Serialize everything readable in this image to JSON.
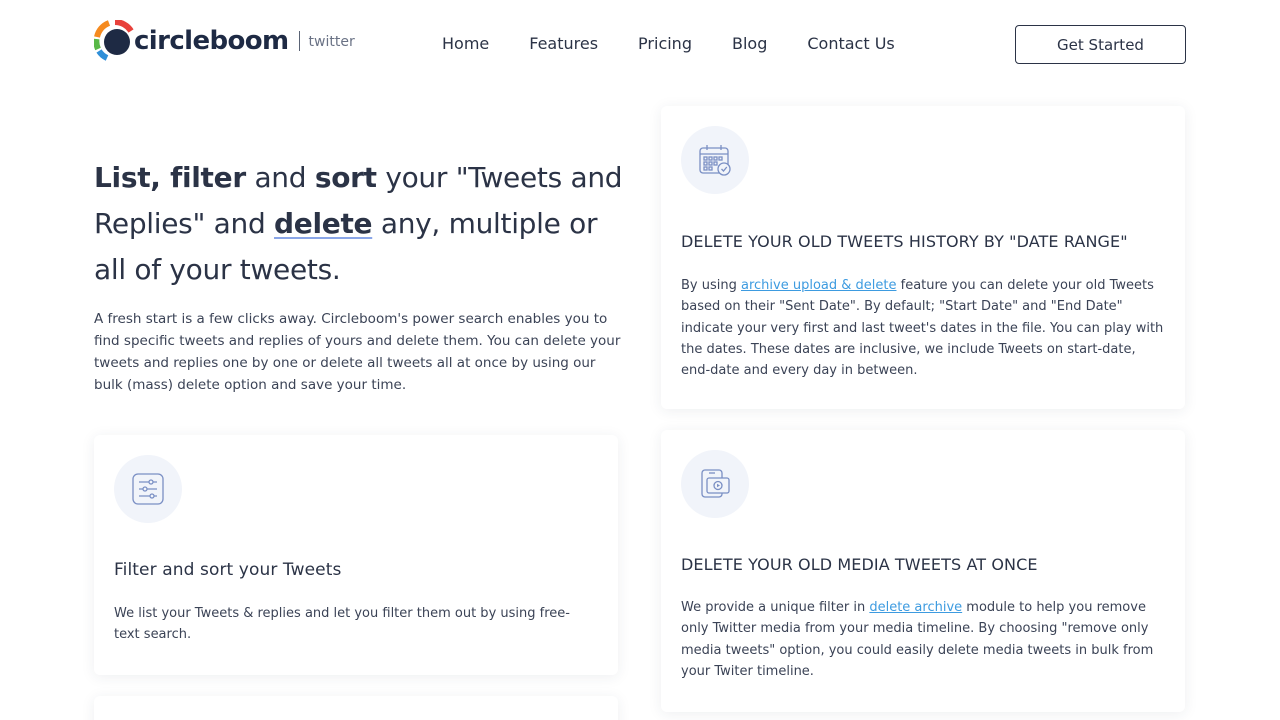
{
  "brand": {
    "name": "circleboom",
    "sub": "twitter",
    "colors": {
      "primary": "#1e2a44",
      "orange": "#f58a1f",
      "green": "#58b847",
      "blue": "#2f8fd8",
      "red": "#e8413b"
    }
  },
  "nav": {
    "items": [
      "Home",
      "Features",
      "Pricing",
      "Blog",
      "Contact Us"
    ],
    "cta": "Get Started"
  },
  "hero": {
    "title": {
      "p1": "List, filter",
      "p2": " and ",
      "p3": "sort",
      "p4": " your \"Tweets and Replies\" and ",
      "p5": "delete",
      "p6": " any, multiple or all of your tweets."
    },
    "text": "A fresh start is a few clicks away. Circleboom's power search enables you to find specific tweets and replies of yours and delete them. You can delete your tweets and replies one by one or delete all tweets all at once by using our bulk (mass) delete option and save your time."
  },
  "cards": {
    "date_range": {
      "icon": "calendar-check-icon",
      "title": "DELETE YOUR OLD TWEETS HISTORY BY \"DATE RANGE\"",
      "text_before": "By using ",
      "link": "archive upload & delete",
      "text_after": " feature you can delete your old Tweets based on their \"Sent Date\". By default; \"Start Date\" and \"End Date\" indicate your very first and last tweet's dates in the file. You can play with the dates. These dates are inclusive, we include Tweets on start-date, end-date and every day in between."
    },
    "media": {
      "icon": "media-device-icon",
      "title": "DELETE YOUR OLD MEDIA TWEETS AT ONCE",
      "text_before": "We provide a unique filter in ",
      "link": "delete archive",
      "text_after": " module to help you remove only Twitter media from your media timeline. By choosing \"remove only media tweets\" option, you could easily delete media tweets in bulk from your Twiter timeline."
    },
    "filter": {
      "icon": "filter-sliders-icon",
      "title": "Filter and sort your Tweets",
      "text": "We list your Tweets & replies and let you filter them out by using free-text search."
    }
  }
}
